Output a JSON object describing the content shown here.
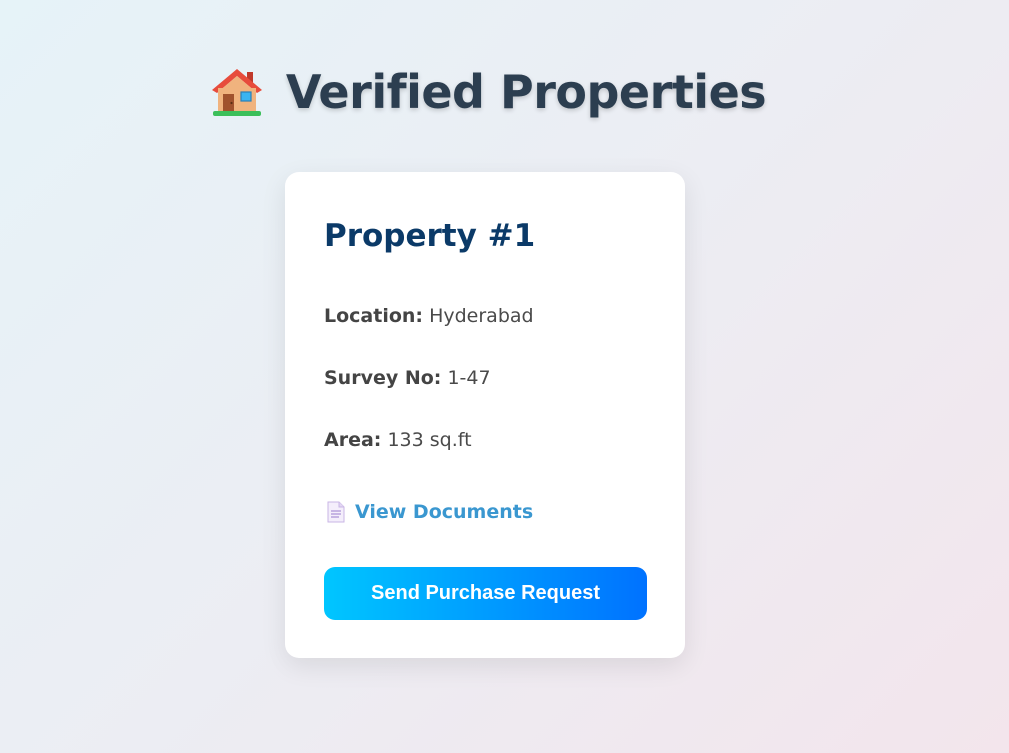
{
  "header": {
    "icon": "house-icon",
    "title": "Verified Properties"
  },
  "property": {
    "title": "Property #1",
    "location_label": "Location:",
    "location_value": "Hyderabad",
    "survey_label": "Survey No:",
    "survey_value": "1-47",
    "area_label": "Area:",
    "area_value": "133 sq.ft",
    "docs_icon": "document-icon",
    "docs_link": "View Documents",
    "purchase_button": "Send Purchase Request"
  },
  "colors": {
    "title_text": "#2c3e50",
    "card_title": "#0b3a68",
    "link": "#3a97d0",
    "button_start": "#00c6ff",
    "button_end": "#0072ff"
  }
}
